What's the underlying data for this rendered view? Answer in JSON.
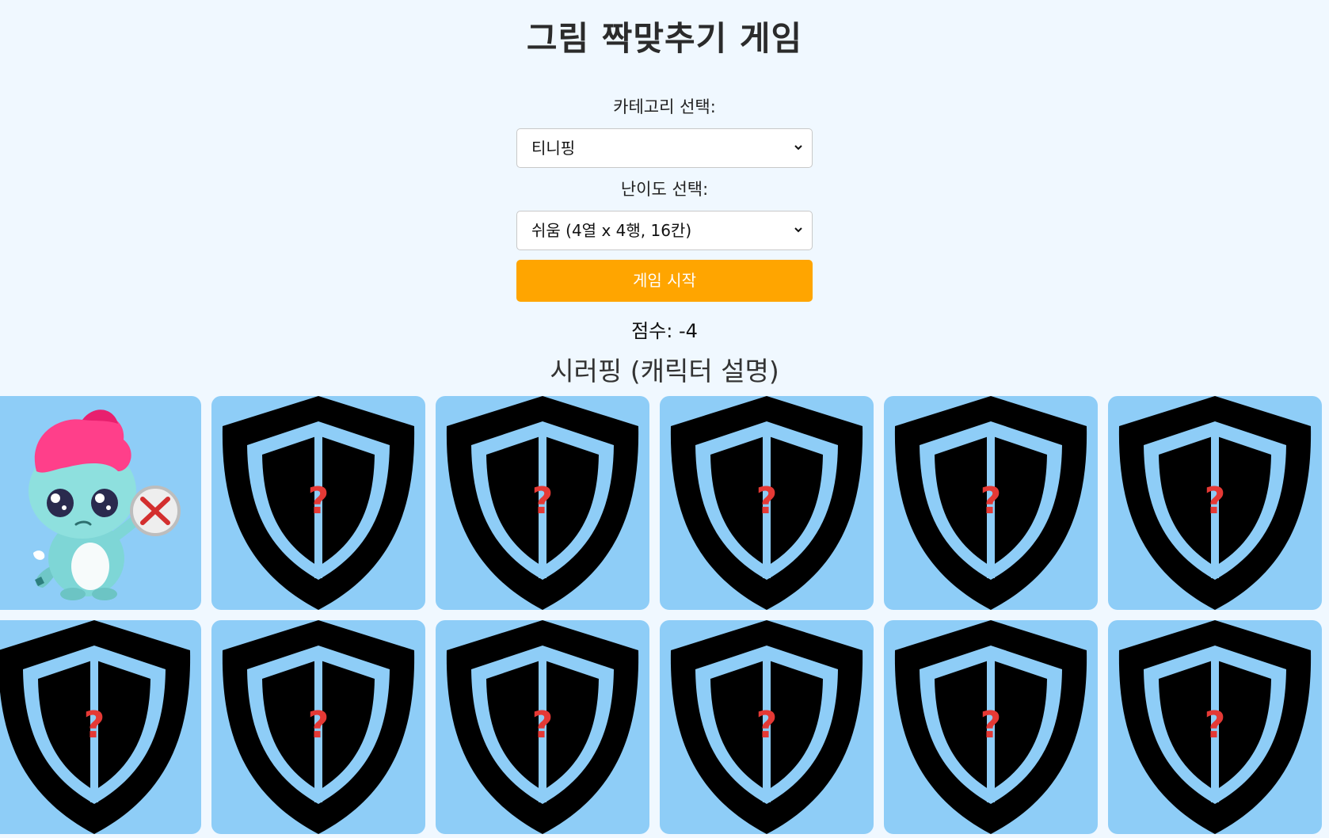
{
  "header": {
    "title": "그림 짝맞추기 게임"
  },
  "controls": {
    "category_label": "카테고리 선택:",
    "category_value": "티니핑",
    "level_label": "난이도 선택:",
    "level_value": "쉬움 (4열 x 4행, 16칸)",
    "start_label": "게임 시작"
  },
  "status": {
    "score_text": "점수: -4",
    "character_caption": "시러핑 (캐릭터 설명)"
  },
  "board": {
    "colors": {
      "card_bg": "#8ecdf7",
      "shield": "#000000",
      "question_mark": "#e53935"
    },
    "card_back_icon": "shield-question-icon",
    "revealed_character": "시러핑",
    "cards": [
      {
        "state": "revealed"
      },
      {
        "state": "hidden"
      },
      {
        "state": "hidden"
      },
      {
        "state": "hidden"
      },
      {
        "state": "hidden"
      },
      {
        "state": "hidden"
      },
      {
        "state": "hidden"
      },
      {
        "state": "hidden"
      },
      {
        "state": "hidden"
      },
      {
        "state": "hidden"
      },
      {
        "state": "hidden"
      },
      {
        "state": "hidden"
      }
    ]
  }
}
